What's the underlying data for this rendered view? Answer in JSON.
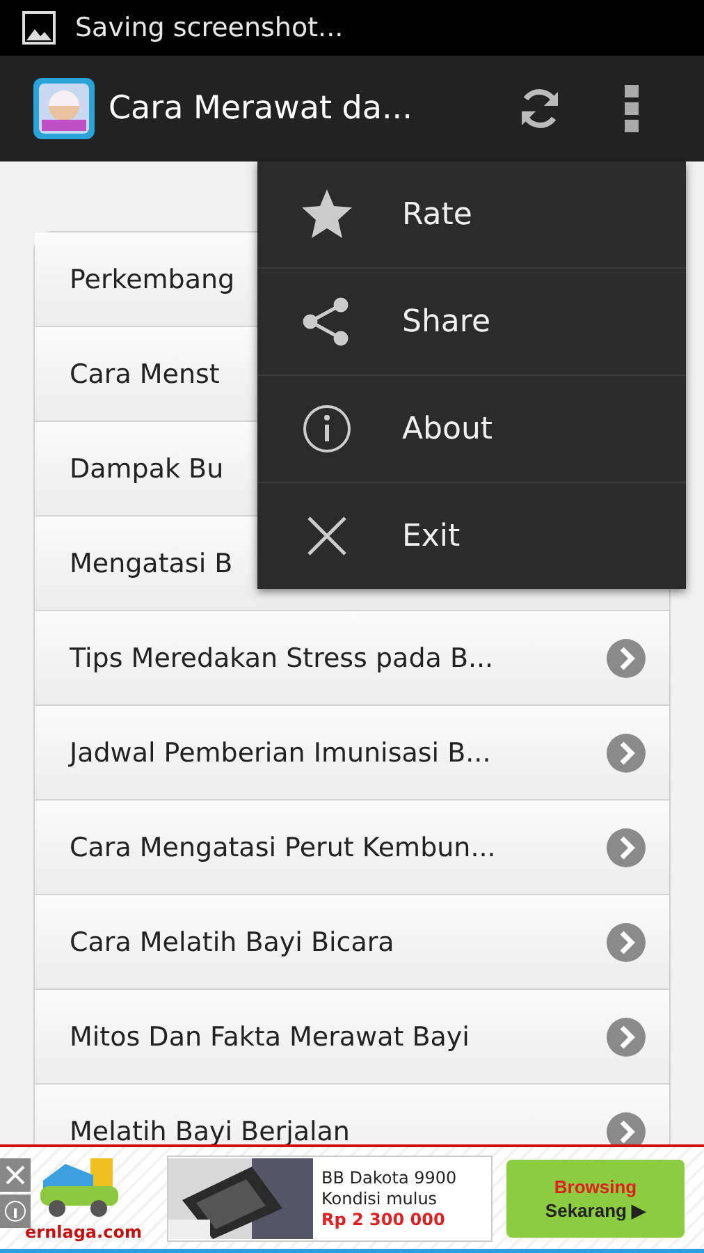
{
  "status_bar": {
    "notification": "Saving screenshot..."
  },
  "action_bar": {
    "title": "Cara Merawat da..."
  },
  "list": [
    {
      "kind": "covered",
      "label": "Perkembang"
    },
    {
      "kind": "covered",
      "label": "Cara Menst"
    },
    {
      "kind": "covered",
      "label": "Dampak Bu"
    },
    {
      "kind": "covered",
      "label": "Mengatasi B"
    },
    {
      "kind": "full",
      "label": "Tips Meredakan Stress pada B..."
    },
    {
      "kind": "full",
      "label": "Jadwal Pemberian Imunisasi B..."
    },
    {
      "kind": "full",
      "label": "Cara Mengatasi Perut Kembun..."
    },
    {
      "kind": "full",
      "label": "Cara Melatih Bayi Bicara"
    },
    {
      "kind": "full",
      "label": "Mitos Dan Fakta Merawat Bayi"
    },
    {
      "kind": "full",
      "label": "Melatih Bayi Berjalan"
    }
  ],
  "menu": [
    {
      "kind": "star",
      "label": "Rate"
    },
    {
      "kind": "share",
      "label": "Share"
    },
    {
      "kind": "info",
      "label": "About"
    },
    {
      "kind": "close",
      "label": "Exit"
    }
  ],
  "ad": {
    "brand": "ernlaga.com",
    "product_line_1": "BB Dakota 9900",
    "product_line_2": "Kondisi mulus",
    "price": "Rp 2 300 000",
    "cta_line_1": "Browsing",
    "cta_line_2": "Sekarang ▶"
  }
}
